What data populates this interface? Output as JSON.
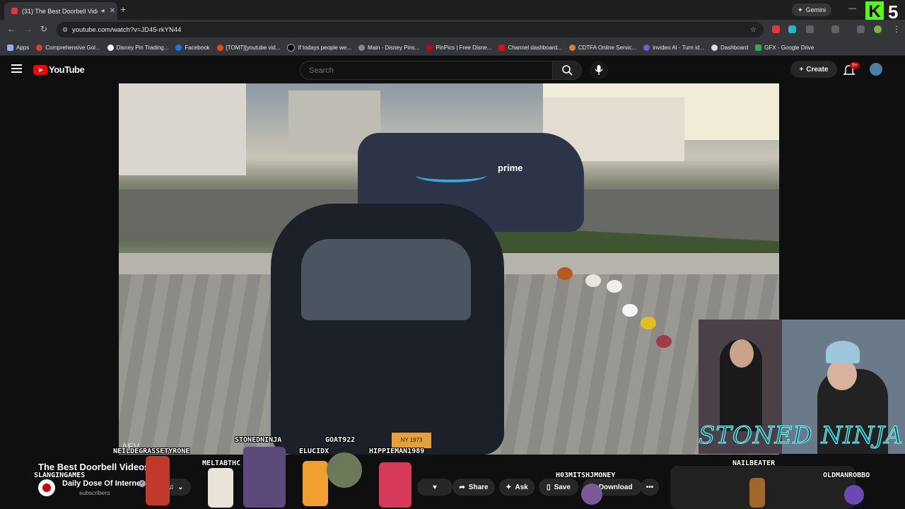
{
  "browser": {
    "tab_title": "(31) The Best Doorbell Vide",
    "new_tab": "+",
    "gemini_label": "Gemini",
    "url": "youtube.com/watch?v=JD45-rkYN44",
    "kick_logo": "K",
    "kick_number": "5",
    "bookmarks": [
      {
        "label": "Apps",
        "color": "#8ab4f8"
      },
      {
        "label": "Comprehensive Gol...",
        "color": "#e53935"
      },
      {
        "label": "Disney Pin Trading...",
        "color": "#ffffff"
      },
      {
        "label": "Facebook",
        "color": "#1877f2"
      },
      {
        "label": "[TOMT][youtube vid...",
        "color": "#ff4500"
      },
      {
        "label": "If todays people we...",
        "color": "#000000"
      },
      {
        "label": "Main - Disney Pins...",
        "color": "#888888"
      },
      {
        "label": "PinPics | Free Disne...",
        "color": "#cc0000"
      },
      {
        "label": "Channel dashboard...",
        "color": "#ff0000"
      },
      {
        "label": "CDTFA Online Servic...",
        "color": "#e67e22"
      },
      {
        "label": "invideo AI - Turn id...",
        "color": "#6c5ce7"
      },
      {
        "label": "Dashboard",
        "color": "#dddddd"
      },
      {
        "label": "GFX - Google Drive",
        "color": "#34a853"
      }
    ]
  },
  "youtube": {
    "logo_text": "YouTube",
    "search_placeholder": "Search",
    "create_label": "Create",
    "notif_badge": "9+"
  },
  "video": {
    "van_text": "prime",
    "plate_text": "NY 1973",
    "watermark": "AEV"
  },
  "overlay": {
    "names": [
      "NEILDEGRASSETYRONE",
      "STONEDNINJA",
      "GOAT922",
      "MELTABTHC",
      "ELUCIDX",
      "HIPPIEMAN1989",
      "H03MITSHJMONEY",
      "NAILBEATER",
      "OLDMANROBBO",
      "SLANGINGAMES"
    ],
    "webcam_title": "STONED NINJA"
  },
  "info": {
    "title": "The Best Doorbell Videos",
    "channel": "Daily Dose Of Internet",
    "subscribers": "subscribers",
    "verified_mark": "✓",
    "share_label": "Share",
    "ask_label": "Ask",
    "save_label": "Save",
    "download_label": "Download",
    "more_label": "•••"
  }
}
